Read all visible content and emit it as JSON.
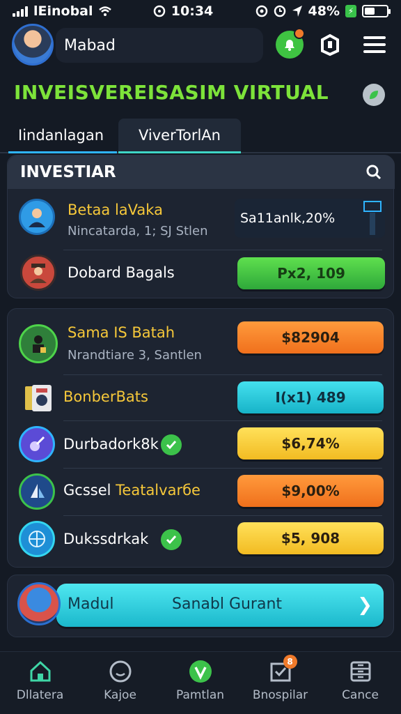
{
  "status_bar": {
    "carrier": "lEinobal",
    "time": "10:34",
    "battery_percent": "48%",
    "battery_level": 0.48
  },
  "header": {
    "user_name": "Mabad",
    "notification_count": ""
  },
  "title": "INVEISVEREISASIM VIRTUAL",
  "tabs": [
    {
      "label": "Iindanlagan",
      "active": true
    },
    {
      "label": "ViverTorlAn",
      "active": false
    }
  ],
  "invest_card": {
    "heading": "INVESTIAR",
    "rows": [
      {
        "name": "Betaa laVaka",
        "sub": "Nincatarda, 1; SJ Stlen",
        "value": "Sa11anlk,20%"
      },
      {
        "name": "Dobard Bagals",
        "value": "Px2, 109"
      }
    ]
  },
  "assets_card": {
    "rows": [
      {
        "name": "Sama IS Batah",
        "sub": "Nrandtiare 3, Santlen",
        "value": "$82904",
        "color": "orange"
      },
      {
        "name": "BonberBats",
        "value": "I(x1) 489",
        "color": "cyan"
      },
      {
        "name": "Durbadork8k",
        "value": "$6,74%",
        "color": "yellow",
        "verified": true
      },
      {
        "name": "Gcssel",
        "name_highlight": "Teatalvarбe",
        "value": "$9,00%",
        "color": "orange"
      },
      {
        "name": "Dukssdrkak",
        "value": "$5, 908",
        "color": "yellow",
        "verified": true
      }
    ]
  },
  "cta": {
    "left_label": "Madul",
    "right_label": "Sanabl Gurant"
  },
  "bottom_nav": [
    {
      "label": "Dllatera",
      "icon": "house-icon"
    },
    {
      "label": "Kajoe",
      "icon": "smile-icon"
    },
    {
      "label": "Pamtlan",
      "icon": "check-circle-icon"
    },
    {
      "label": "Bnospilar",
      "icon": "checkbox-icon",
      "badge": "8"
    },
    {
      "label": "Cance",
      "icon": "cabinet-icon"
    }
  ],
  "colors": {
    "accent_green": "#7de33a",
    "accent_cyan": "#1bb8cc",
    "accent_orange": "#f0701c",
    "accent_yellow": "#f2bb22"
  }
}
